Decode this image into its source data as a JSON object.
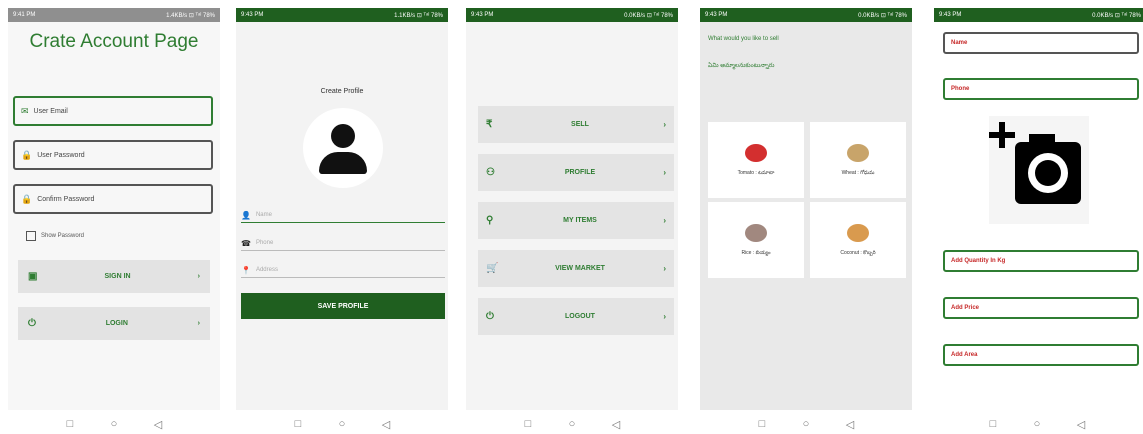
{
  "screen1": {
    "status_left": "9:41 PM",
    "status_right": "1.4KB/s ⊡ ᵀᵃˡ 78%",
    "title": "Crate Account Page",
    "email_placeholder": "User Email",
    "password_placeholder": "User Password",
    "confirm_placeholder": "Confirm Password",
    "show_password": "Show Password",
    "signin_label": "SIGN IN",
    "login_label": "LOGIN"
  },
  "screen2": {
    "status_left": "9:43 PM",
    "status_right": "1.1KB/s ⊡ ᵀᵃˡ 78%",
    "title": "Create Profile",
    "name_placeholder": "Name",
    "phone_placeholder": "Phone",
    "address_placeholder": "Address",
    "save_label": "SAVE PROFILE"
  },
  "screen3": {
    "status_left": "9:43 PM",
    "status_right": "0.0KB/s ⊡ ᵀᵃˡ 78%",
    "menu": [
      {
        "icon": "rupee-icon",
        "glyph": "₹",
        "label": "SELL"
      },
      {
        "icon": "person-icon",
        "glyph": "⚇",
        "label": "PROFILE"
      },
      {
        "icon": "items-icon",
        "glyph": "⚲",
        "label": "MY ITEMS"
      },
      {
        "icon": "cart-icon",
        "glyph": "🛒",
        "label": "VIEW MARKET"
      },
      {
        "icon": "power-icon",
        "glyph": "⏻",
        "label": "LOGOUT"
      }
    ]
  },
  "screen4": {
    "status_left": "9:43 PM",
    "status_right": "0.0KB/s ⊡ ᵀᵃˡ 78%",
    "question": "What would you like to sell",
    "question_local": "ఏమి అమ్మాలనుకుంటున్నారు",
    "tiles": [
      {
        "caption": "Tomato : టమాటా",
        "color": "#d32f2f"
      },
      {
        "caption": "Wheat : గోధుమ",
        "color": "#c8a46a"
      },
      {
        "caption": "Rice : బియ్యం",
        "color": "#a1887f"
      },
      {
        "caption": "Coconut : కొబ్బరి",
        "color": "#d99a4e"
      }
    ]
  },
  "screen5": {
    "status_left": "9:43 PM",
    "status_right": "0.0KB/s ⊡ ᵀᵃˡ 78%",
    "name_placeholder": "Name",
    "phone_placeholder": "Phone",
    "quantity_placeholder": "Add Quantity In Kg",
    "price_placeholder": "Add Price",
    "area_placeholder": "Add Area"
  },
  "nav": {
    "recent": "□",
    "home": "○",
    "back": "◁"
  }
}
